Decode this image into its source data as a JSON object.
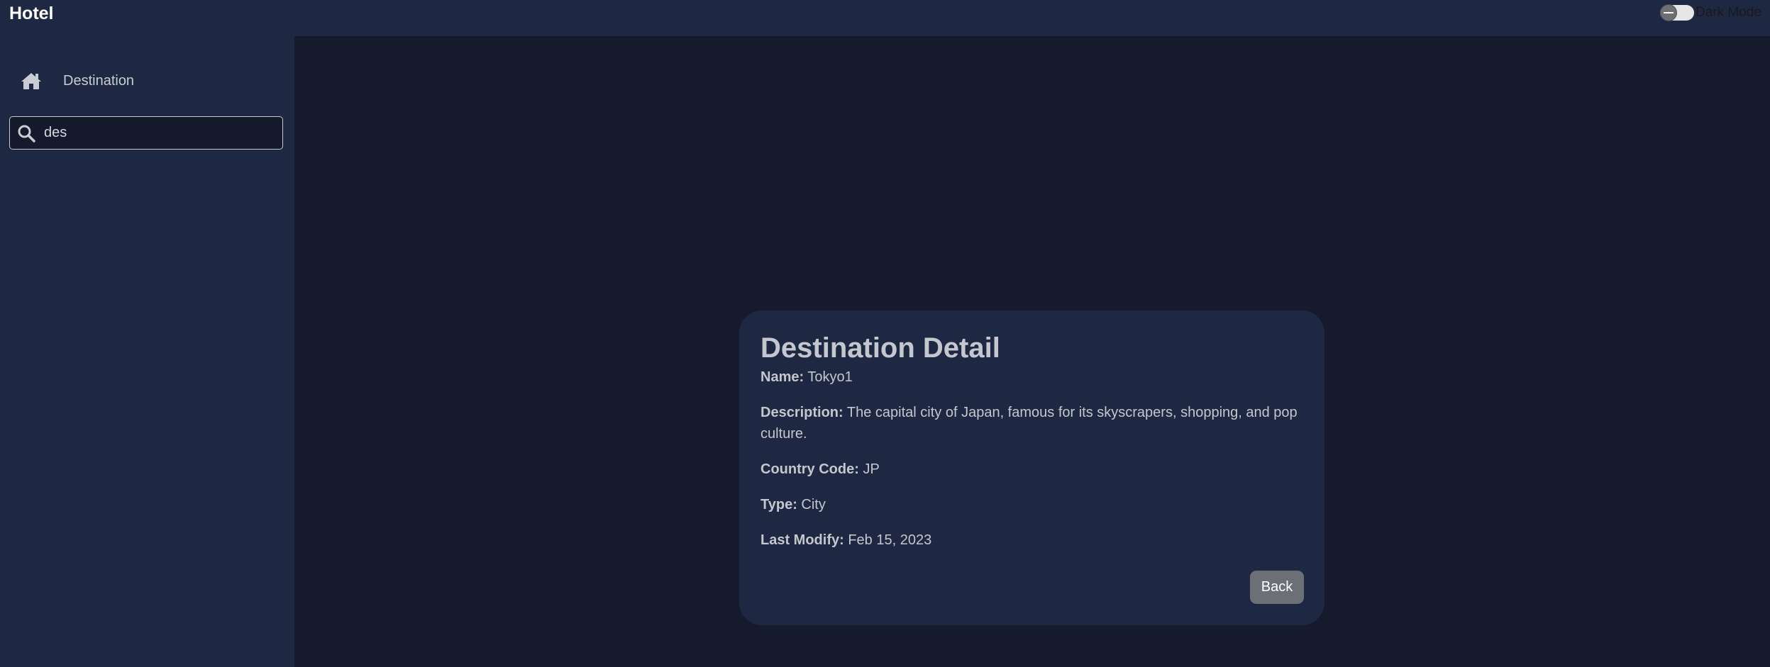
{
  "app": {
    "title": "Hotel"
  },
  "header": {
    "dark_mode_label": "Dark Mode",
    "dark_mode_on": false
  },
  "sidebar": {
    "items": [
      {
        "label": "Destination",
        "icon": "home-icon"
      }
    ],
    "search": {
      "value": "des",
      "icon": "search-icon"
    }
  },
  "detail": {
    "title": "Destination Detail",
    "name_label": "Name:",
    "name_value": "Tokyo1",
    "description_label": "Description:",
    "description_value": "The capital city of Japan, famous for its skyscrapers, shopping, and pop culture.",
    "country_code_label": "Country Code:",
    "country_code_value": "JP",
    "type_label": "Type:",
    "type_value": "City",
    "last_modify_label": "Last Modify:",
    "last_modify_value": "Feb 15, 2023",
    "back_label": "Back"
  },
  "colors": {
    "page_background": "#151b2d",
    "panel_background": "#1e2842",
    "text_muted": "#c4c7ce",
    "button_gray": "#6c7076"
  }
}
